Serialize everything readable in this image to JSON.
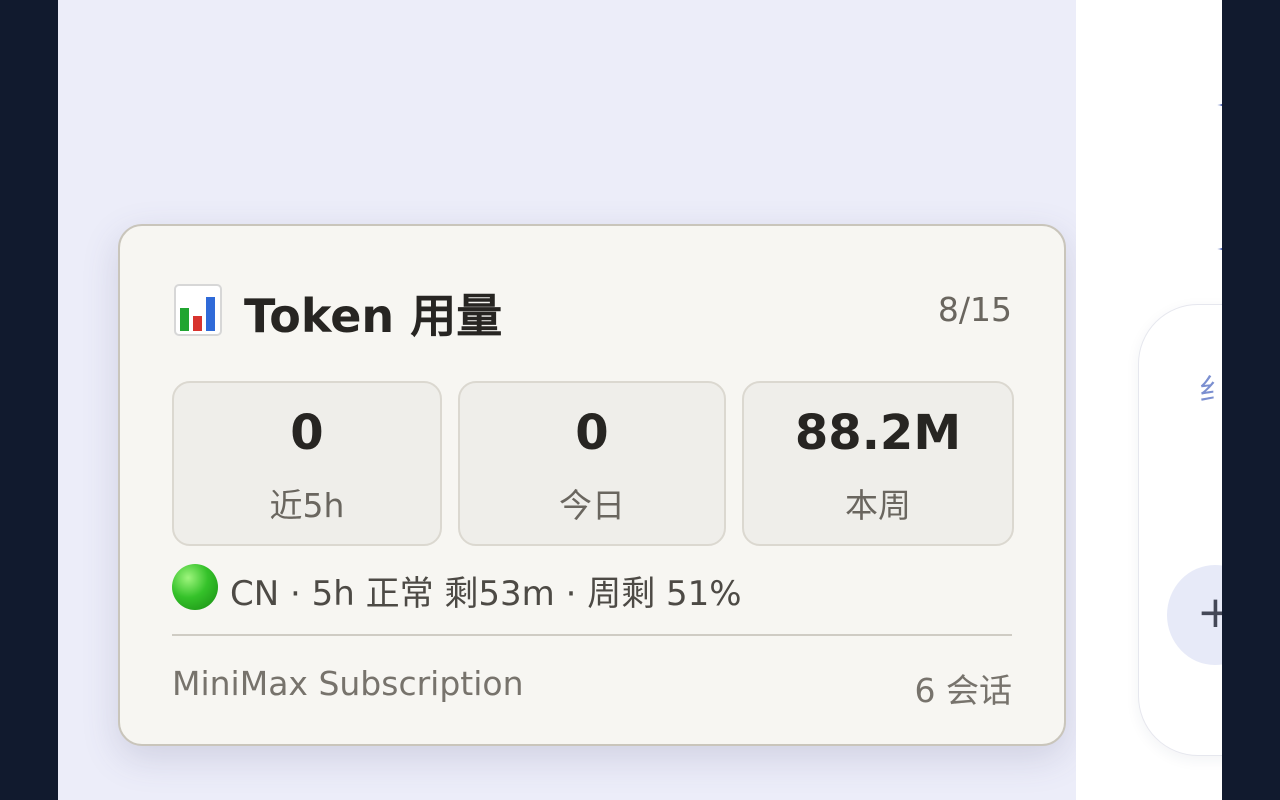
{
  "usage_card": {
    "title": "Token 用量",
    "date": "8/15",
    "icon": "bar-chart-icon",
    "stats": [
      {
        "value": "0",
        "label": "近5h"
      },
      {
        "value": "0",
        "label": "今日"
      },
      {
        "value": "88.2M",
        "label": "本周"
      }
    ],
    "status": {
      "color": "#2db82a",
      "text": "CN · 5h 正常 剩53m · 周剩 51%"
    },
    "footer": {
      "plan": "MiniMax Subscription",
      "sessions": "6 会话"
    }
  },
  "composer": {
    "partial_text": "纟",
    "add_label": "+"
  },
  "colors": {
    "left_background": "#ecedf9",
    "card_background": "#f7f6f2",
    "outer_frame": "#111a2e",
    "accent": "#4b62b4"
  }
}
